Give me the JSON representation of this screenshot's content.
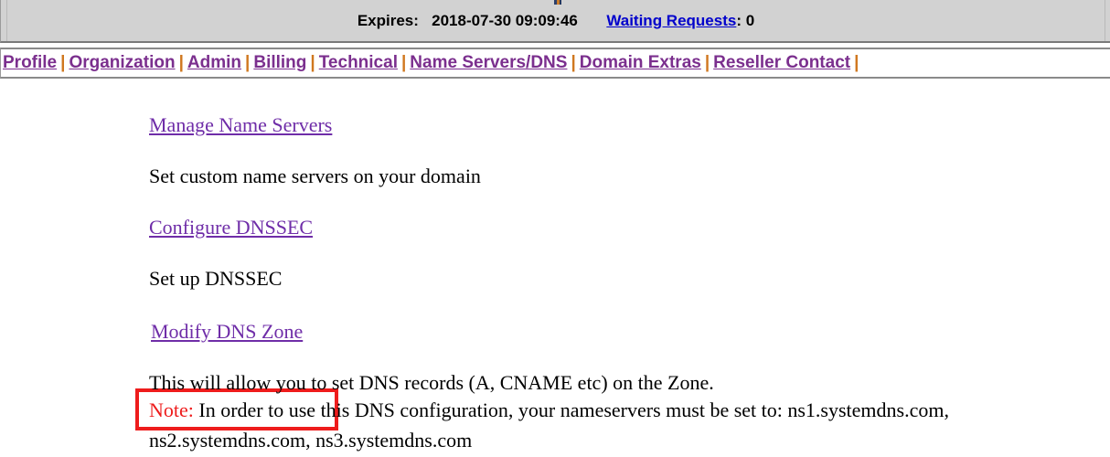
{
  "status_bar": {
    "expires_label": "Expires:",
    "expires_value": "2018-07-30 09:09:46",
    "waiting_requests_link": "Waiting Requests",
    "waiting_requests_count": ": 0",
    "background_color": "#d2d2d2",
    "link_color": "#0000cc"
  },
  "nav": {
    "separator": "|",
    "separator_color": "#d07820",
    "link_color": "#7b2f8e",
    "items": [
      {
        "label": "Profile"
      },
      {
        "label": "Organization"
      },
      {
        "label": "Admin"
      },
      {
        "label": "Billing"
      },
      {
        "label": "Technical"
      },
      {
        "label": "Name Servers/DNS"
      },
      {
        "label": "Domain Extras"
      },
      {
        "label": "Reseller Contact"
      }
    ]
  },
  "content": {
    "link_color": "#6f2da8",
    "sections": [
      {
        "link": "Manage Name Servers",
        "description": "Set custom name servers on your domain"
      },
      {
        "link": "Configure DNSSEC",
        "description": "Set up DNSSEC"
      },
      {
        "link": "Modify DNS Zone",
        "description_line1": "This will allow you to set DNS records (A, CNAME etc) on the Zone.",
        "note_label": "Note:",
        "note_line1": " In order to use this DNS configuration, your nameservers must be set to: ns1.systemdns.com,",
        "note_line2": "ns2.systemdns.com, ns3.systemdns.com"
      }
    ]
  },
  "annotation": {
    "highlight_color": "#ee1c1c",
    "highlight_target": "Modify DNS Zone"
  }
}
